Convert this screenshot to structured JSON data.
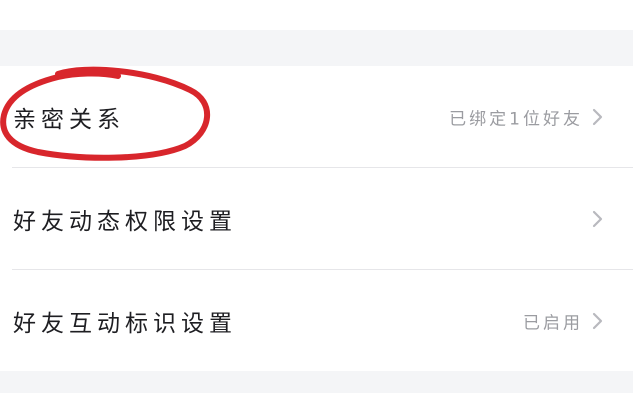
{
  "settings": {
    "items": [
      {
        "label": "亲密关系",
        "value": "已绑定1位好友",
        "icon": "chevron-right-icon"
      },
      {
        "label": "好友动态权限设置",
        "value": "",
        "icon": "chevron-right-icon"
      },
      {
        "label": "好友互动标识设置",
        "value": "已启用",
        "icon": "chevron-right-icon"
      }
    ]
  },
  "colors": {
    "section_gap": "#f4f5f7",
    "label_text": "#1e1e22",
    "value_text": "#9b9ca1",
    "chevron": "#b8b9be",
    "annotation_circle": "#d8262c"
  }
}
